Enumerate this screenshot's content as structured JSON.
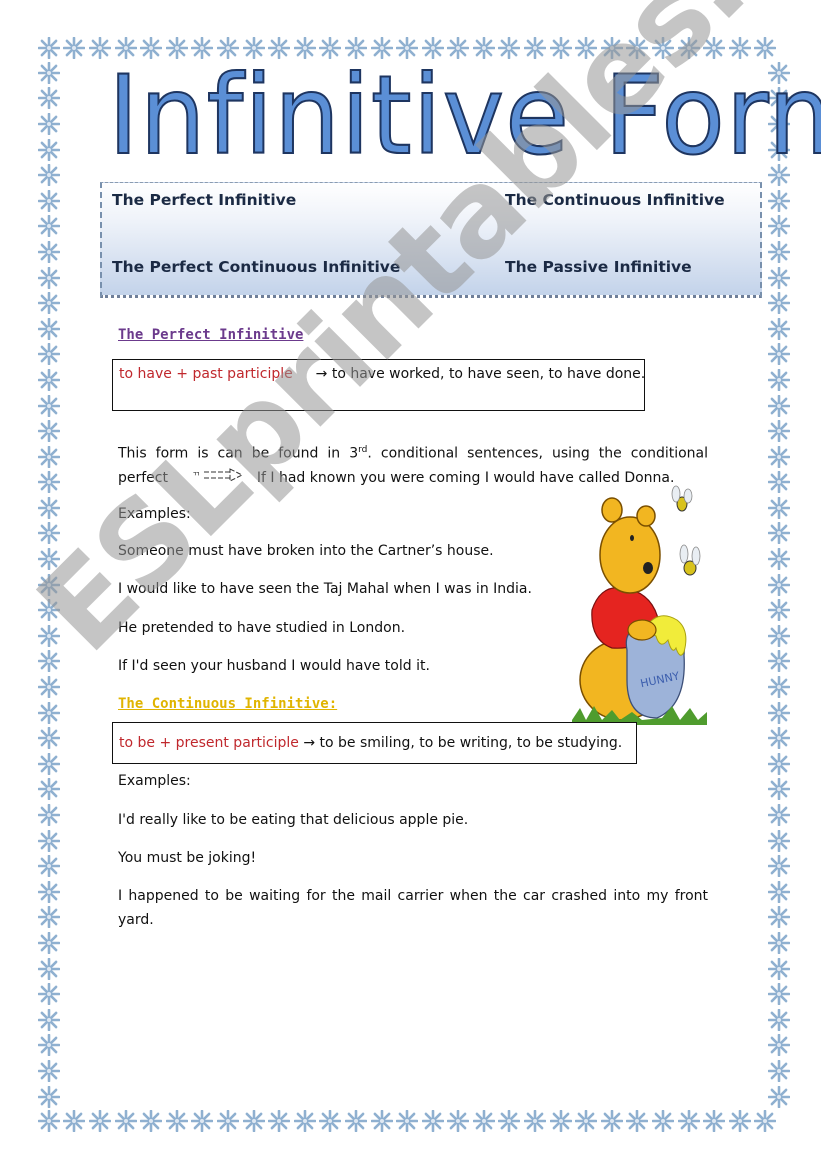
{
  "title": "Infinitive Forms",
  "header_menu": {
    "items": [
      {
        "label": "The Perfect Infinitive"
      },
      {
        "label": "The Continuous Infinitive"
      },
      {
        "label": "The Perfect Continuous Infinitive"
      },
      {
        "label": "The Passive Infinitive"
      }
    ]
  },
  "perfect": {
    "heading": "The Perfect Infinitive",
    "heading_color": "#6b3a8c",
    "formula": "to have + past participle",
    "examples_inline": "→ to have worked, to have seen, to have done.",
    "explanation_part1": "This form is can be found in 3",
    "explanation_sup": "rd",
    "explanation_part2": ". conditional sentences, using the conditional",
    "explanation_line2_start": "perfect",
    "explanation_line2_example": "If I had known you were coming I would have called Donna.",
    "arrow_icon": "arrow-right-icon",
    "examples_label": "Examples:",
    "examples": [
      "Someone must have broken into the Cartner’s house.",
      "I would like to have seen the Taj Mahal when I was in India.",
      "He pretended to have studied in London.",
      "If I'd seen your husband I would have told it."
    ]
  },
  "continuous": {
    "heading": "The Continuous Infinitive:",
    "heading_color": "#e0b400",
    "formula": "to be + present participle",
    "examples_inline": "→ to be smiling, to be writing, to be studying.",
    "examples_label": "Examples:",
    "examples": [
      "I'd really like to be eating that delicious apple pie.",
      "You must be joking!",
      "I happened to be waiting for the mail carrier when the car crashed into my front"
    ],
    "examples_continuation": "yard."
  },
  "watermark": "ESLprintables.com",
  "colors": {
    "title_fill": "#5b8fd6",
    "snowflake": "#8fb0d0",
    "formula_red": "#c0282d"
  }
}
